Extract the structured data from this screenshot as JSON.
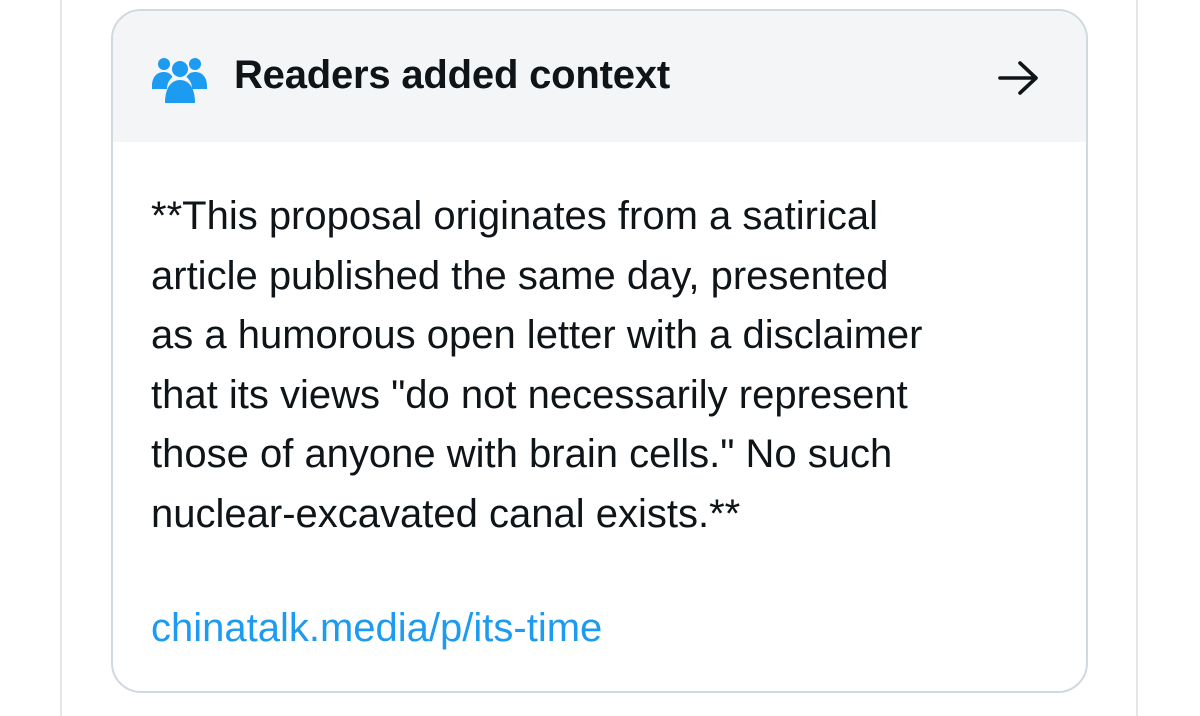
{
  "note": {
    "header_title": "Readers added context",
    "header_icon": "people-group-icon",
    "header_arrow_icon": "arrow-right-icon",
    "body_text": "**This proposal originates from a satirical\narticle published the same day, presented\nas a humorous open letter with a disclaimer\nthat its views \"do not necessarily represent\nthose of anyone with brain cells.\" No such\nnuclear-excavated canal exists.**",
    "link_text": "chinatalk.media/p/its-time"
  },
  "colors": {
    "icon_blue": "#1d9bf0",
    "link_blue": "#1d9bf0",
    "text": "#0f1419",
    "header_bg": "#f4f5f6",
    "border": "#cfd9de"
  }
}
